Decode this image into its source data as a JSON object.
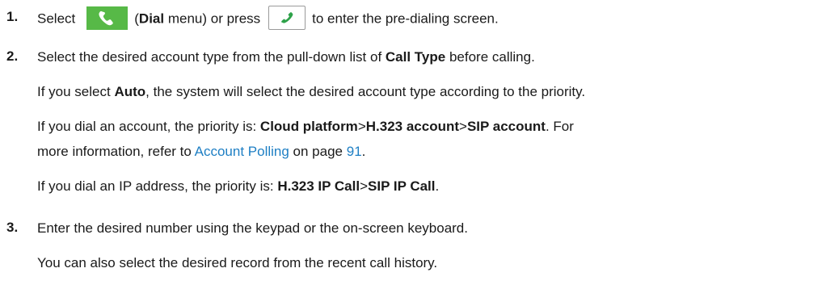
{
  "step1": {
    "num": "1.",
    "select": "Select",
    "dial_icon": "phone-handset-icon",
    "open_paren": "(",
    "dial": "Dial",
    "menu_or_press": " menu) or press",
    "key_icon": "offhook-key-icon",
    "rest": "to enter the pre-dialing screen.",
    "colors": {
      "dial_icon_bg": "#57b947",
      "key_handset": "#2ea24a"
    }
  },
  "step2": {
    "num": "2.",
    "text_a": "Select the desired account type from the pull-down list of ",
    "call_type": "Call Type",
    "text_b": " before calling.",
    "auto_a": "If you select ",
    "auto": "Auto",
    "auto_b": ", the system will select the desired account type according to the priority.",
    "acct_a": "If you dial an account, the priority is: ",
    "cloud": "Cloud platform",
    "gt1": ">",
    "h323_account": "H.323 account",
    "gt2": ">",
    "sip_account": "SIP account",
    "acct_b": ". For",
    "more_a": "more information, refer to ",
    "account_polling": "Account Polling",
    "on_page": " on page ",
    "page": "91",
    "period": ".",
    "ip_a": "If you dial an IP address, the priority is: ",
    "h323_ip": "H.323 IP Call",
    "gt3": ">",
    "sip_ip": "SIP IP Call",
    "ip_b": "."
  },
  "step3": {
    "num": "3.",
    "text": "Enter the desired number using the keypad or the on-screen keyboard.",
    "history": "You can also select the desired record from the recent call history."
  },
  "link_color": "#1e7fc4"
}
